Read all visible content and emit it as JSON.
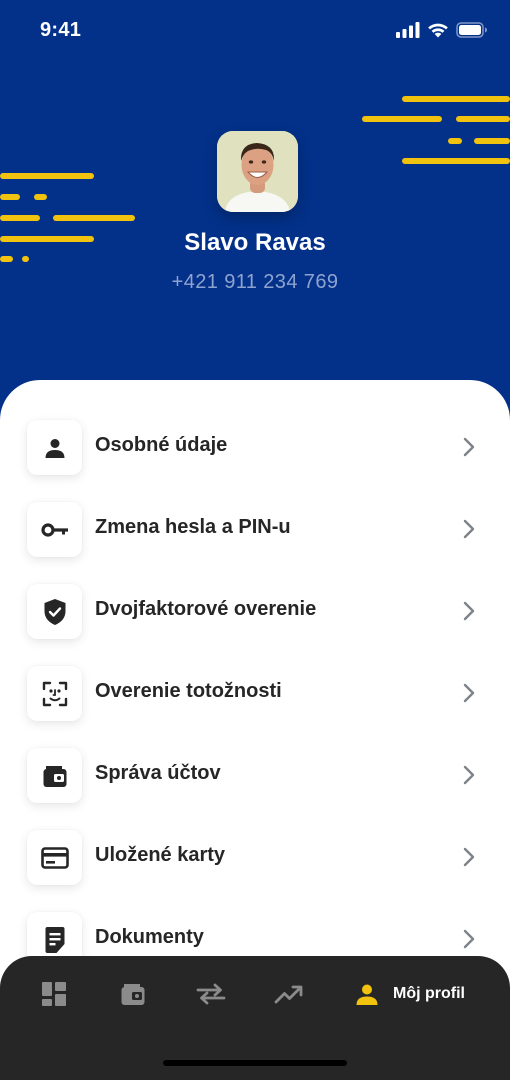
{
  "status_bar": {
    "time": "9:41"
  },
  "profile": {
    "name": "Slavo Ravas",
    "phone": "+421 911 234 769"
  },
  "menu": {
    "items": [
      {
        "label": "Osobné údaje",
        "icon": "person-icon"
      },
      {
        "label": "Zmena hesla a PIN-u",
        "icon": "key-icon"
      },
      {
        "label": "Dvojfaktorové overenie",
        "icon": "shield-check-icon"
      },
      {
        "label": "Overenie totožnosti",
        "icon": "face-id-icon"
      },
      {
        "label": "Správa účtov",
        "icon": "wallet-icon"
      },
      {
        "label": "Uložené karty",
        "icon": "credit-card-icon"
      },
      {
        "label": "Dokumenty",
        "icon": "document-icon"
      }
    ]
  },
  "tab_bar": {
    "tabs": [
      {
        "icon": "dashboard-icon",
        "label": "",
        "active": false
      },
      {
        "icon": "wallet-icon",
        "label": "",
        "active": false
      },
      {
        "icon": "transfer-icon",
        "label": "",
        "active": false
      },
      {
        "icon": "trending-up-icon",
        "label": "",
        "active": false
      },
      {
        "icon": "person-icon",
        "label": "Môj profil",
        "active": true
      }
    ]
  },
  "colors": {
    "header_bg": "#03318a",
    "accent_yellow": "#f1c20e",
    "tab_bar_bg": "#262626",
    "text_dark": "#262626",
    "phone_text": "#8ea3cf"
  }
}
